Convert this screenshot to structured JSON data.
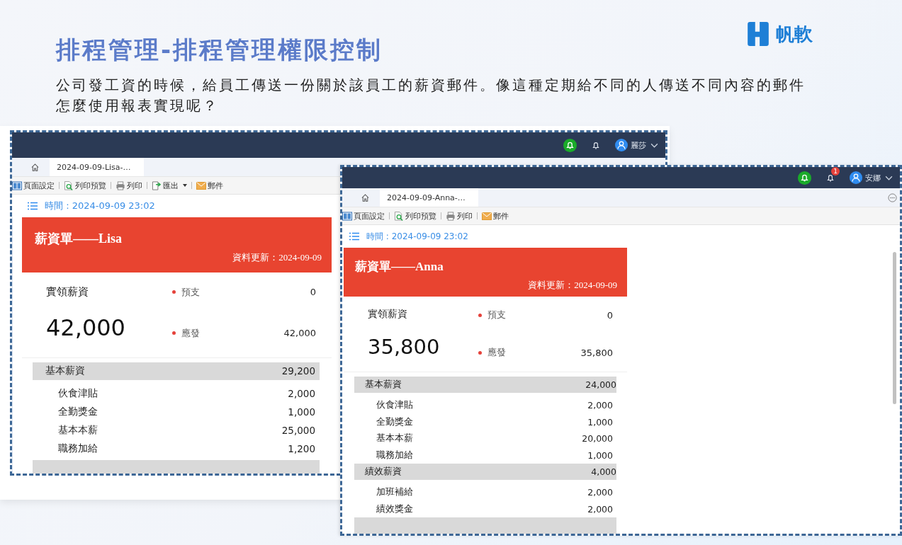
{
  "slide": {
    "title": "排程管理-排程管理權限控制",
    "logo_text": "帆軟",
    "paragraph": "公司發工資的時候，給員工傳送一份關於該員工的薪資郵件。像這種定期給不同的人傳送不同內容的郵件怎麼使用報表實現呢？"
  },
  "windows": [
    {
      "user": "麗莎",
      "tab": "2024-09-09-Lisa-…",
      "more_menu": false,
      "toolbar": [
        {
          "kind": "page-setup",
          "label": "頁面設定",
          "dropdown": false
        },
        {
          "kind": "print-preview",
          "label": "列印預覽",
          "dropdown": false
        },
        {
          "kind": "print",
          "label": "列印",
          "dropdown": false
        },
        {
          "kind": "export",
          "label": "匯出",
          "dropdown": true
        },
        {
          "kind": "mail",
          "label": "郵件",
          "dropdown": false
        }
      ],
      "time": "時間 : 2024-09-09 23:02",
      "payslip_title": "薪資單——Lisa",
      "updated": "資料更新：2024-09-09",
      "net_label": "實領薪資",
      "net_amount": "42,000",
      "summary": [
        {
          "label": "預支",
          "value": "0"
        },
        {
          "label": "應發",
          "value": "42,000"
        }
      ],
      "sections": [
        {
          "label": "基本薪資",
          "value": "29,200",
          "children": [
            {
              "label": "伙食津貼",
              "value": "2,000"
            },
            {
              "label": "全勤獎金",
              "value": "1,000"
            },
            {
              "label": "基本本薪",
              "value": "25,000"
            },
            {
              "label": "職務加給",
              "value": "1,200"
            }
          ]
        }
      ]
    },
    {
      "user": "安娜",
      "badge": "1",
      "tab": "2024-09-09-Anna-…",
      "more_menu": true,
      "toolbar": [
        {
          "kind": "page-setup",
          "label": "頁面設定",
          "dropdown": false
        },
        {
          "kind": "print-preview",
          "label": "列印預覽",
          "dropdown": false
        },
        {
          "kind": "print",
          "label": "列印",
          "dropdown": false
        },
        {
          "kind": "mail",
          "label": "郵件",
          "dropdown": false
        }
      ],
      "time": "時間 : 2024-09-09 23:02",
      "payslip_title": "薪資單——Anna",
      "updated": "資料更新：2024-09-09",
      "net_label": "實領薪資",
      "net_amount": "35,800",
      "summary": [
        {
          "label": "預支",
          "value": "0"
        },
        {
          "label": "應發",
          "value": "35,800"
        }
      ],
      "sections": [
        {
          "label": "基本薪資",
          "value": "24,000",
          "children": [
            {
              "label": "伙食津貼",
              "value": "2,000"
            },
            {
              "label": "全勤獎金",
              "value": "1,000"
            },
            {
              "label": "基本本薪",
              "value": "20,000"
            },
            {
              "label": "職務加給",
              "value": "1,000"
            }
          ]
        },
        {
          "label": "績效薪資",
          "value": "4,000",
          "children": [
            {
              "label": "加班補給",
              "value": "2,000"
            },
            {
              "label": "績效獎金",
              "value": "2,000"
            }
          ]
        }
      ]
    }
  ]
}
